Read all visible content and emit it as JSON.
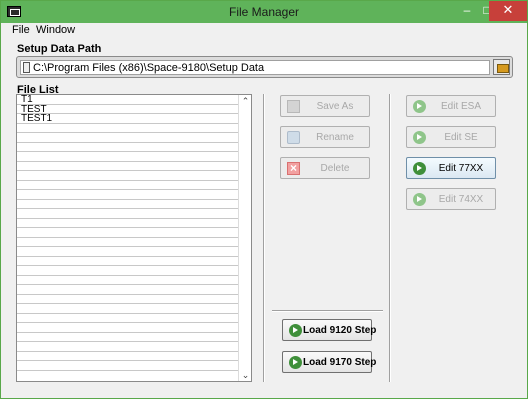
{
  "window": {
    "title": "File Manager",
    "minimize": "‒",
    "maximize": "□",
    "close": "✕"
  },
  "menu": {
    "file": "File",
    "window": "Window"
  },
  "setup": {
    "label": "Setup Data Path",
    "path": "C:\\Program Files (x86)\\Space-9180\\Setup Data"
  },
  "file_list": {
    "label": "File List",
    "items": [
      "T1",
      "TEST",
      "TEST1",
      "",
      "",
      "",
      "",
      "",
      "",
      "",
      "",
      "",
      "",
      "",
      "",
      "",
      "",
      "",
      "",
      "",
      "",
      "",
      "",
      "",
      "",
      "",
      "",
      "",
      ""
    ]
  },
  "scroll": {
    "up": "⌃",
    "down": "⌄"
  },
  "actions": {
    "save_as": "Save As",
    "rename": "Rename",
    "delete": "Delete",
    "load_9120": "Load 9120 Step",
    "load_9170": "Load 9170 Step"
  },
  "edit": {
    "esa": "Edit ESA",
    "se": "Edit SE",
    "x77": "Edit 77XX",
    "x74": "Edit 74XX"
  }
}
